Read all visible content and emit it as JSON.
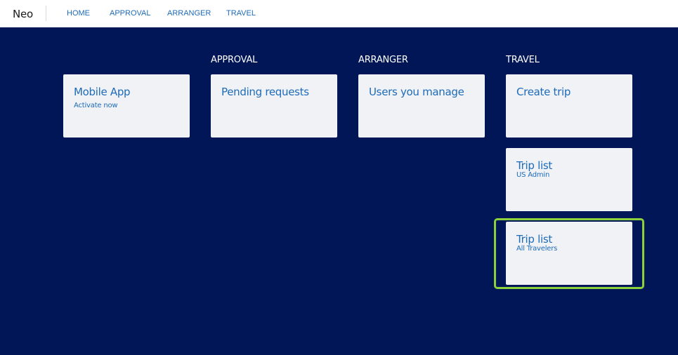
{
  "app": {
    "brand": "Neo"
  },
  "nav": {
    "home": "HOME",
    "approval": "APPROVAL",
    "arranger": "ARRANGER",
    "travel": "TRAVEL"
  },
  "columns": {
    "approval": "APPROVAL",
    "arranger": "ARRANGER",
    "travel": "TRAVEL"
  },
  "tiles": {
    "mobile_app": {
      "title": "Mobile App",
      "subtitle": "Activate now"
    },
    "pending_requests": {
      "title": "Pending requests"
    },
    "users_you_manage": {
      "title": "Users you manage"
    },
    "create_trip": {
      "title": "Create trip"
    },
    "trip_list_admin": {
      "title": "Trip list",
      "subtitle": "US Admin"
    },
    "trip_list_all": {
      "title": "Trip list",
      "subtitle": "All Travelers"
    }
  },
  "colors": {
    "background": "#001656",
    "tile": "#f0f2f6",
    "link": "#1e6bb8",
    "highlight": "#8bd13b"
  }
}
